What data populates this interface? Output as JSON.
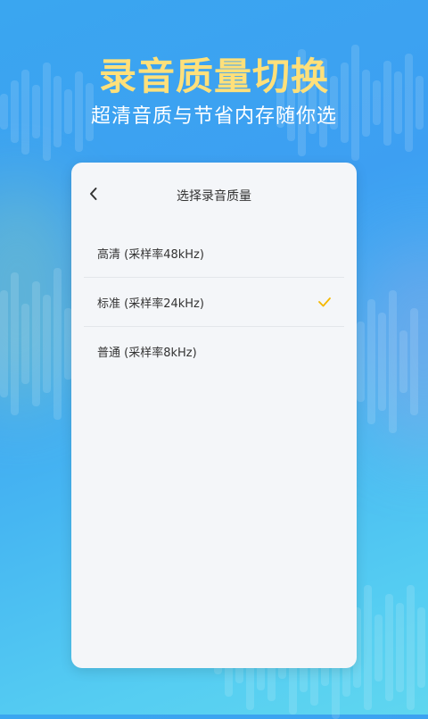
{
  "promo": {
    "headline": "录音质量切换",
    "subheadline": "超清音质与节省内存随你选"
  },
  "dialog": {
    "title": "选择录音质量",
    "back_icon": "chevron-left-icon",
    "options": [
      {
        "label": "高清 (采样率48kHz)",
        "selected": false
      },
      {
        "label": "标准 (采样率24kHz)",
        "selected": true
      },
      {
        "label": "普通 (采样率8kHz)",
        "selected": false
      }
    ],
    "check_icon": "checkmark-icon"
  },
  "colors": {
    "headline": "#ffe07a",
    "accent_check": "#f5b800",
    "card_bg": "#f4f6f9",
    "background_top": "#3aa6f0",
    "background_bottom": "#5fd6ef"
  }
}
